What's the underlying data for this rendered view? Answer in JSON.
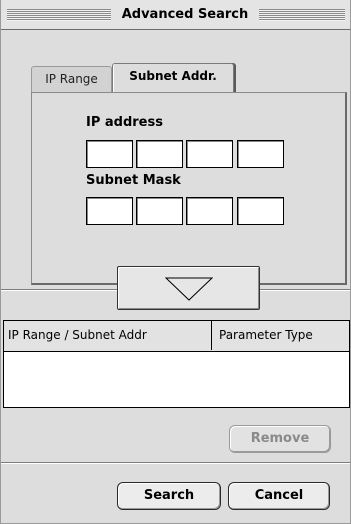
{
  "window": {
    "title": "Advanced Search"
  },
  "tabs": [
    {
      "label": "IP Range",
      "active": false
    },
    {
      "label": "Subnet Addr.",
      "active": true
    }
  ],
  "form": {
    "ip_address_label": "IP address",
    "subnet_mask_label": "Subnet Mask",
    "ip_address_octets": [
      "",
      "",
      "",
      ""
    ],
    "subnet_mask_octets": [
      "",
      "",
      "",
      ""
    ]
  },
  "add_button": {
    "icon": "triangle-down-icon"
  },
  "table": {
    "columns": [
      "IP Range / Subnet Addr",
      "Parameter Type"
    ],
    "rows": []
  },
  "buttons": {
    "remove": "Remove",
    "search": "Search",
    "cancel": "Cancel"
  },
  "colors": {
    "window_bg": "#dddddd",
    "disabled_text": "#8a8a8a"
  }
}
